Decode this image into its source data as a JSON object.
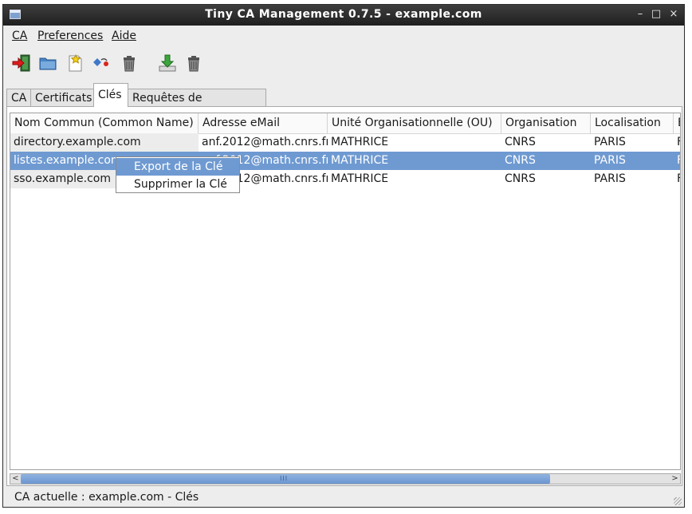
{
  "window": {
    "title": "Tiny CA Management 0.7.5 - example.com"
  },
  "titlebar_buttons": {
    "minimize": "–",
    "maximize": "□",
    "close": "×"
  },
  "menubar": {
    "items": [
      {
        "label": "CA"
      },
      {
        "label": "Preferences"
      },
      {
        "label": "Aide"
      }
    ]
  },
  "toolbar": {
    "buttons": [
      {
        "icon": "exit-icon"
      },
      {
        "icon": "open-folder-icon"
      },
      {
        "icon": "new-icon"
      },
      {
        "icon": "import-icon"
      },
      {
        "icon": "trash-icon"
      },
      {
        "icon": "download-icon"
      },
      {
        "icon": "delete-icon"
      }
    ]
  },
  "tabs": [
    {
      "label": "CA"
    },
    {
      "label": "Certificats"
    },
    {
      "label": "Clés",
      "active": true
    },
    {
      "label": "Requêtes de certification"
    }
  ],
  "table": {
    "columns": [
      {
        "label": "Nom Commun (Common Name)",
        "sort_indicator": "⌄"
      },
      {
        "label": "Adresse eMail"
      },
      {
        "label": "Unité Organisationnelle (OU)"
      },
      {
        "label": "Organisation"
      },
      {
        "label": "Localisation"
      },
      {
        "label": "E"
      }
    ],
    "rows": [
      {
        "cells": [
          "directory.example.com",
          "anf.2012@math.cnrs.fr",
          "MATHRICE",
          "CNRS",
          "PARIS",
          "F"
        ],
        "selected": false
      },
      {
        "cells": [
          "listes.example.com",
          "anf.2012@math.cnrs.fr",
          "MATHRICE",
          "CNRS",
          "PARIS",
          "F"
        ],
        "selected": true
      },
      {
        "cells": [
          "sso.example.com",
          "anf.2012@math.cnrs.fr",
          "MATHRICE",
          "CNRS",
          "PARIS",
          "F"
        ],
        "selected": false
      }
    ]
  },
  "context_menu": {
    "items": [
      {
        "label": "Export de la Clé",
        "highlighted": true
      },
      {
        "label": "Supprimer la Clé",
        "highlighted": false
      }
    ]
  },
  "scrollbar": {
    "left_arrow": "<",
    "right_arrow": ">",
    "grip": "III"
  },
  "status": {
    "text": "CA actuelle : example.com - Clés"
  },
  "colors": {
    "selection": "#6f9ad1",
    "titlebar": "#2b2b2b",
    "window_bg": "#ededed"
  }
}
